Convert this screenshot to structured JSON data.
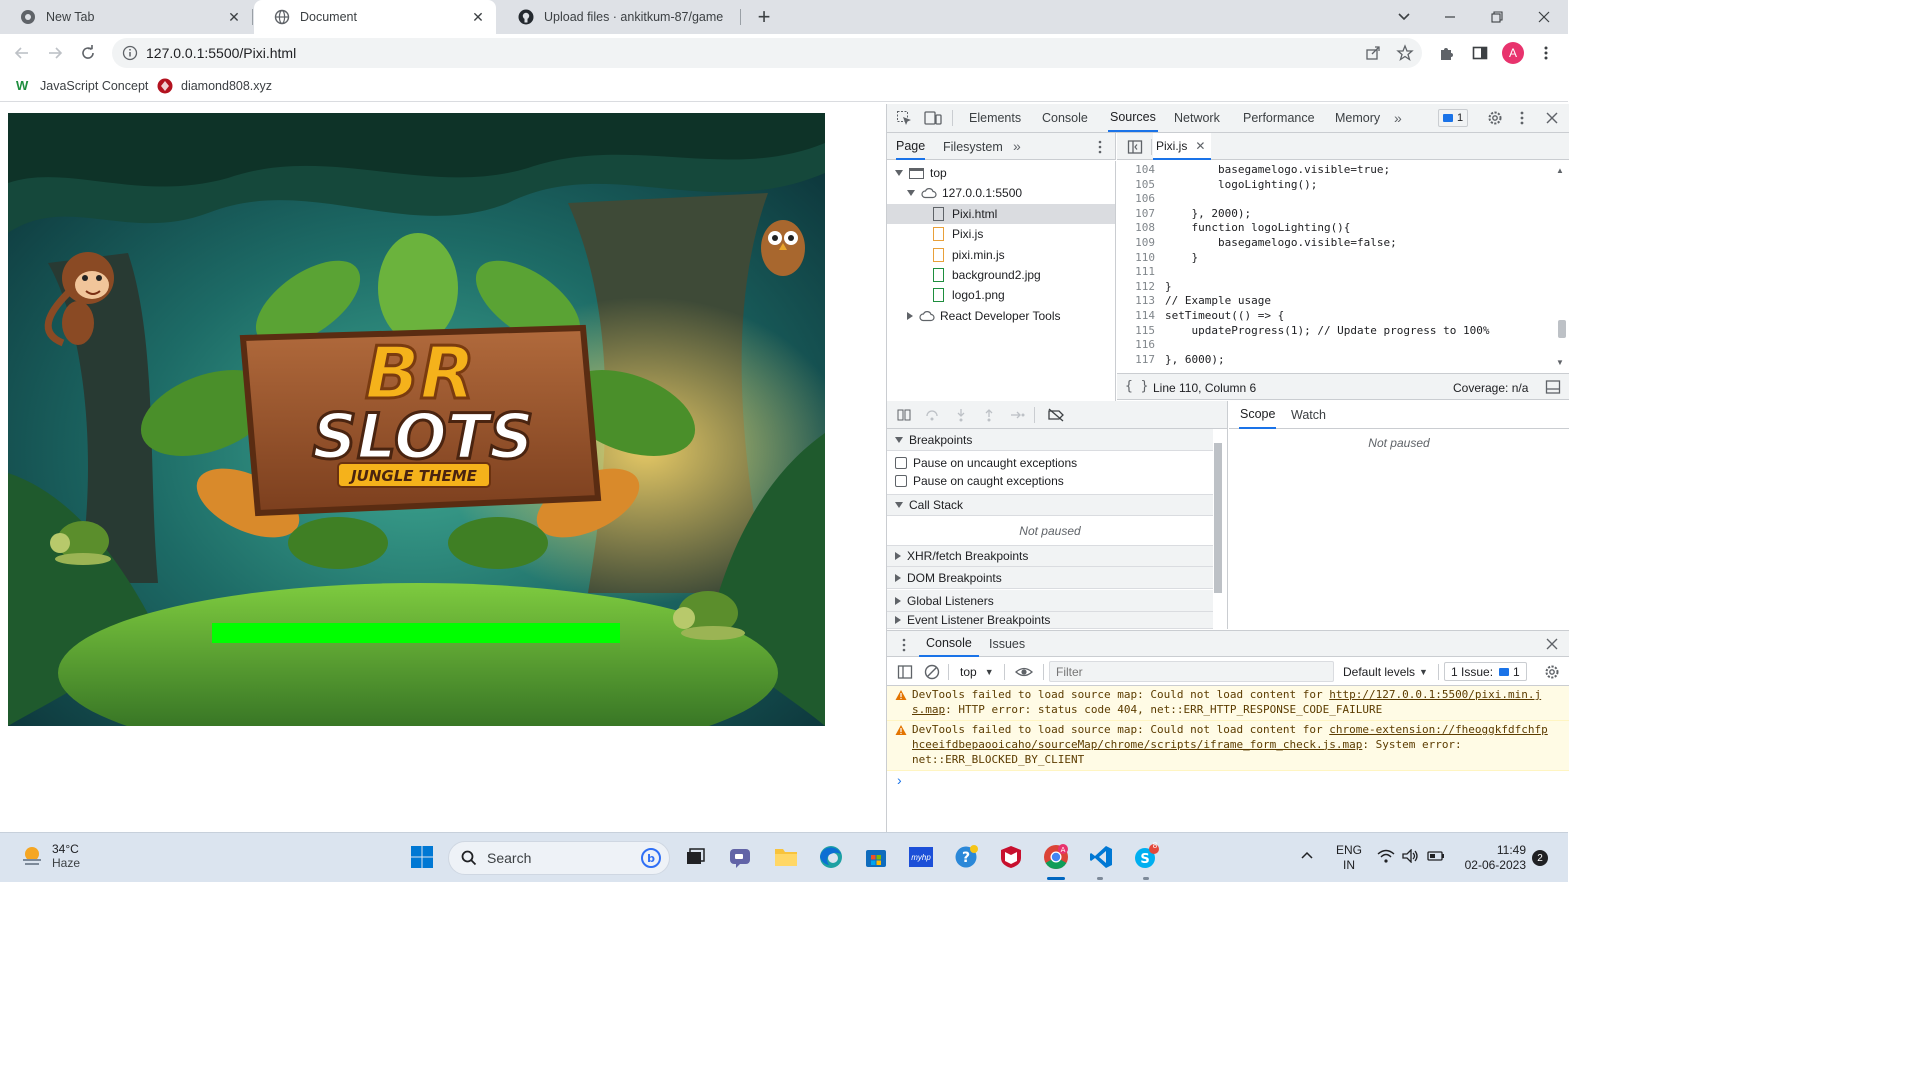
{
  "browser": {
    "tabs": [
      {
        "title": "New Tab",
        "active": false
      },
      {
        "title": "Document",
        "active": true
      },
      {
        "title": "Upload files · ankitkum-87/game",
        "active": false
      }
    ],
    "url": "127.0.0.1:5500/Pixi.html",
    "profile_initial": "A",
    "bookmarks": [
      "JavaScript Concept",
      "diamond808.xyz"
    ]
  },
  "game": {
    "logo_line1": "BR",
    "logo_line2": "SLOTS",
    "logo_tagline": "JUNGLE THEME",
    "progress_percent": 100,
    "progress_color": "#00ff00"
  },
  "devtools": {
    "main_tabs": [
      "Elements",
      "Console",
      "Sources",
      "Network",
      "Performance",
      "Memory"
    ],
    "selected_tab": "Sources",
    "issues_badge": "1",
    "navigator_tabs": [
      "Page",
      "Filesystem"
    ],
    "tree": {
      "top": "top",
      "origin": "127.0.0.1:5500",
      "files": [
        "Pixi.html",
        "Pixi.js",
        "pixi.min.js",
        "background2.jpg",
        "logo1.png"
      ],
      "react": "React Developer Tools"
    },
    "editor_tab": "Pixi.js",
    "code_lines": [
      {
        "n": "104",
        "text": "        basegamelogo.visible=true;"
      },
      {
        "n": "105",
        "text": "        logoLighting();"
      },
      {
        "n": "106",
        "text": ""
      },
      {
        "n": "107",
        "text": "    }, 2000);"
      },
      {
        "n": "108",
        "text": "    function logoLighting(){"
      },
      {
        "n": "109",
        "text": "        basegamelogo.visible=false;"
      },
      {
        "n": "110",
        "text": "    }"
      },
      {
        "n": "111",
        "text": ""
      },
      {
        "n": "112",
        "text": "}"
      },
      {
        "n": "113",
        "text": "// Example usage"
      },
      {
        "n": "114",
        "text": "setTimeout(() => {"
      },
      {
        "n": "115",
        "text": "    updateProgress(1); // Update progress to 100%"
      },
      {
        "n": "116",
        "text": ""
      },
      {
        "n": "117",
        "text": "}, 6000);"
      }
    ],
    "status_position": "Line 110, Column 6",
    "coverage": "Coverage: n/a",
    "debugger": {
      "breakpoints_title": "Breakpoints",
      "pause_uncaught": "Pause on uncaught exceptions",
      "pause_caught": "Pause on caught exceptions",
      "call_stack_title": "Call Stack",
      "not_paused": "Not paused",
      "sections": [
        "XHR/fetch Breakpoints",
        "DOM Breakpoints",
        "Global Listeners",
        "Event Listener Breakpoints"
      ],
      "scope_tabs": [
        "Scope",
        "Watch"
      ],
      "scope_not_paused": "Not paused"
    },
    "drawer": {
      "tabs": [
        "Console",
        "Issues"
      ],
      "context": "top",
      "filter_placeholder": "Filter",
      "levels": "Default levels",
      "issues_label": "1 Issue:",
      "issues_count": "1",
      "messages": [
        {
          "prefix": "DevTools failed to load source map: Could not load content for ",
          "link": "http://127.0.0.1:5500/pixi.min.js.map",
          "suffix": ": HTTP error: status code 404, net::ERR_HTTP_RESPONSE_CODE_FAILURE"
        },
        {
          "prefix": "DevTools failed to load source map: Could not load content for ",
          "link": "chrome-extension://fheoggkfdfchfphceeifdbepaooicaho/sourceMap/chrome/scripts/iframe_form_check.js.map",
          "suffix": ": System error: net::ERR_BLOCKED_BY_CLIENT"
        }
      ]
    }
  },
  "taskbar": {
    "weather_temp": "34°C",
    "weather_desc": "Haze",
    "search": "Search",
    "lang1": "ENG",
    "lang2": "IN",
    "time": "11:49",
    "date": "02-06-2023",
    "notification_count": "2",
    "skype_badge": "8"
  }
}
